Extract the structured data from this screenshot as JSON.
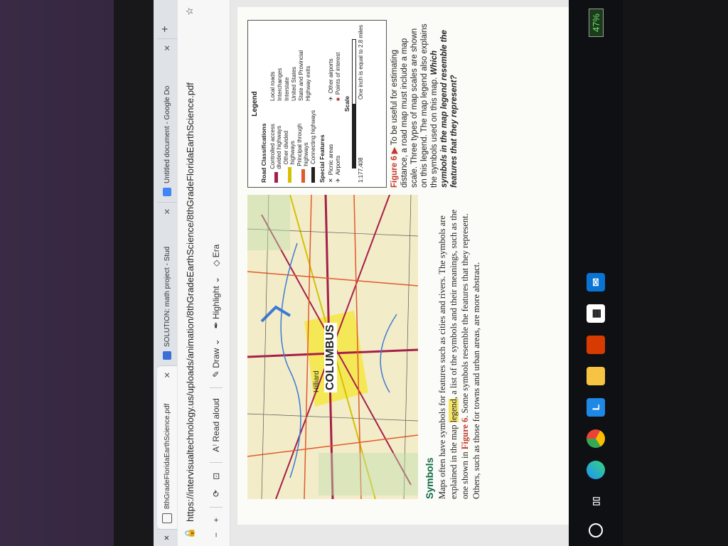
{
  "browser": {
    "tabs": [
      {
        "label": "8thGradeFloridaEarthScience.pdf",
        "active": true,
        "icon": "pdf-icon"
      },
      {
        "label": "SOLUTION: math project - Stud",
        "active": false,
        "icon": "studocu-icon"
      },
      {
        "label": "Untitled document - Google Do",
        "active": false,
        "icon": "google-docs-icon"
      }
    ],
    "url": "https://intervisualtechnology.us/uploads/animation/8thGradeEarthScience/8thGradeFloridaEarthScience.pdf"
  },
  "pdf_toolbar": {
    "minus": "−",
    "plus": "+",
    "read_aloud": "Read aloud",
    "draw": "Draw",
    "highlight": "Highlight",
    "erase": "Era"
  },
  "map": {
    "city_label": "COLUMBUS",
    "secondary_label": "Hilliard"
  },
  "legend": {
    "title": "Legend",
    "road_heading": "Road Classifications",
    "roads_left": [
      {
        "label": "Controlled access divided highways",
        "color": "#a51f4a"
      },
      {
        "label": "Other divided highways",
        "color": "#d4c200"
      },
      {
        "label": "Principal through highways",
        "color": "#e05a2b"
      },
      {
        "label": "Connecting highways",
        "color": "#222222"
      }
    ],
    "roads_right": [
      "Local roads",
      "Interchanges",
      "Interstate",
      "United States",
      "State and Provincial",
      "Highway exits"
    ],
    "special_heading": "Special Features",
    "special_left": [
      "Picnic areas",
      "Airports"
    ],
    "special_right": [
      "Other airports",
      "Points of interest"
    ],
    "scale_heading": "Scale",
    "scale_ratio": "1:177,408",
    "scale_note": "One inch is equal to 2.8 miles"
  },
  "figure_caption": {
    "label": "Figure 6",
    "text": " To be useful for estimating distance, a road map must include a map scale. Three types of map scales are shown on this legend. The map legend also explains the symbols used on this map. ",
    "question": "Which symbols in the map legend resemble the features that they represent?"
  },
  "section": {
    "heading": "Symbols",
    "part1": "Maps often have symbols for features such as cities and rivers. The symbols are explained in the map ",
    "highlight": "legend",
    "part2": ", a list of the symbols and their meanings, such as the one shown in ",
    "fig_ref": "Figure 6",
    "part3": ". Some symbols resemble the features that they represent. Others, such as those for towns and urban areas, are more abstract."
  },
  "taskbar": {
    "battery": "47%",
    "icons": [
      "search-icon",
      "task-view-icon",
      "edge-icon",
      "chrome-icon",
      "launcher-icon",
      "file-explorer-icon",
      "office-icon",
      "store-icon",
      "mail-icon"
    ]
  }
}
